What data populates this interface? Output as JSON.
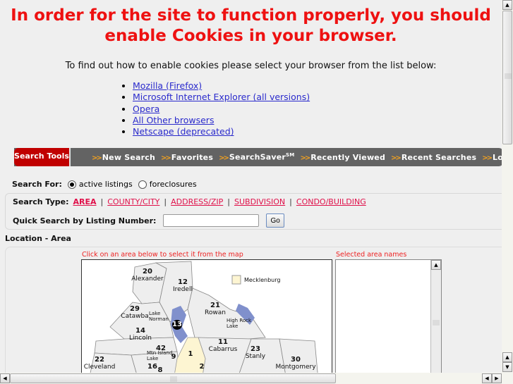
{
  "headline": "In order for the site to function properly, you should enable Cookies in your browser.",
  "instruction": "To find out how to enable cookies please select your browser from the list below:",
  "browsers": [
    "Mozilla (Firefox)",
    "Microsoft Internet Explorer (all versions)",
    "Opera",
    "All Other browsers",
    "Netscape (deprecated)"
  ],
  "toolbar": {
    "tab_label": "Search Tools",
    "arrow": ">>",
    "items": [
      "New Search",
      "Favorites",
      "SearchSaver",
      "Recently Viewed",
      "Recent Searches",
      "Login"
    ],
    "searchsaver_sup": "SM"
  },
  "search_for": {
    "label": "Search For:",
    "options": [
      {
        "label": "active listings",
        "checked": true
      },
      {
        "label": "foreclosures",
        "checked": false
      }
    ]
  },
  "search_type": {
    "label": "Search Type:",
    "options": [
      "AREA",
      "COUNTY/CITY",
      "ADDRESS/ZIP",
      "SUBDIVISION",
      "CONDO/BUILDING"
    ],
    "active": "AREA",
    "separator": "|"
  },
  "quick_search": {
    "label": "Quick Search by Listing Number:",
    "value": "",
    "go_label": "Go"
  },
  "location": {
    "title": "Location - Area",
    "map_hint": "Click on an area below to select it from the map",
    "selected_hint": "Selected area names",
    "legend": "Mecklenburg",
    "legend_color": "#fdf5d2",
    "water_color": "#8090cc",
    "county_fill": "#eeeeee",
    "areas": [
      {
        "num": "20",
        "name": "Alexander"
      },
      {
        "num": "12",
        "name": "Iredell"
      },
      {
        "num": "29",
        "name": "Catawba"
      },
      {
        "num": "21",
        "name": "Rowan"
      },
      {
        "num": "14",
        "name": "Lincoln"
      },
      {
        "num": "11",
        "name": "Cabarrus"
      },
      {
        "num": "23",
        "name": "Stanly"
      },
      {
        "num": "22",
        "name": "Cleveland"
      },
      {
        "num": "16",
        "name": ""
      },
      {
        "num": "30",
        "name": "Montgomery"
      },
      {
        "num": "42",
        "name": ""
      },
      {
        "num": "9",
        "name": ""
      },
      {
        "num": "1",
        "name": ""
      },
      {
        "num": "8",
        "name": ""
      },
      {
        "num": "2",
        "name": ""
      },
      {
        "num": "13",
        "name": ""
      }
    ],
    "lakes": [
      "Lake Norman",
      "High Rock Lake",
      "Mtn Island Lake"
    ]
  }
}
